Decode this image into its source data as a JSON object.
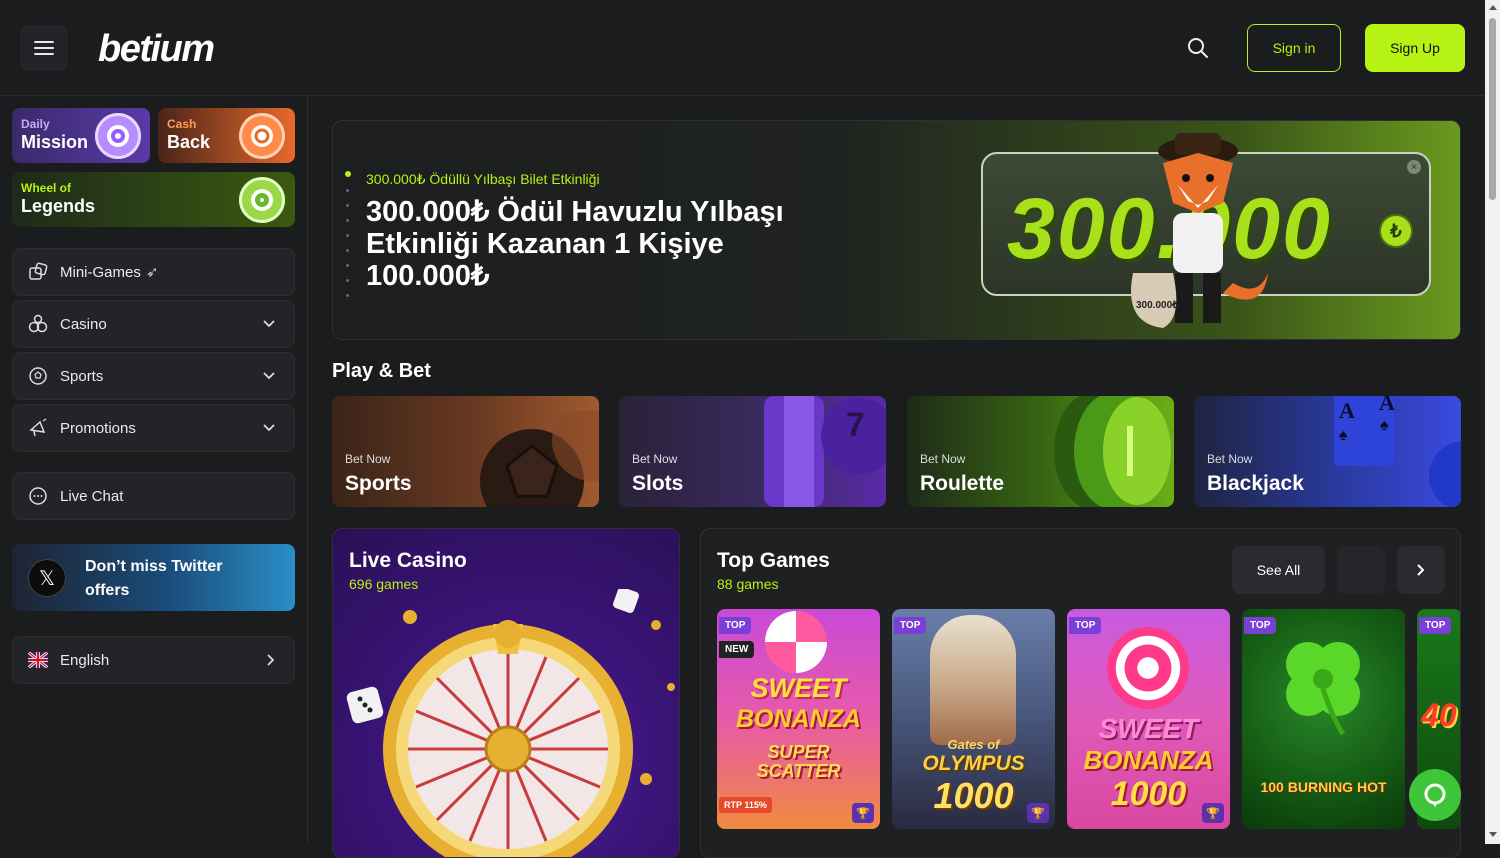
{
  "header": {
    "logo_text": "betium",
    "signin_label": "Sign in",
    "signup_label": "Sign Up"
  },
  "sidebar": {
    "promos": [
      {
        "small": "Daily",
        "big": "Mission"
      },
      {
        "small": "Cash",
        "big": "Back"
      },
      {
        "small": "Wheel of",
        "big": "Legends"
      }
    ],
    "items": [
      {
        "label": "Mini-Games"
      },
      {
        "label": "Casino"
      },
      {
        "label": "Sports"
      },
      {
        "label": "Promotions"
      },
      {
        "label": "Live Chat"
      }
    ],
    "twitter_text": "Don’t miss Twitter offers",
    "language": "English"
  },
  "hero": {
    "subtitle": "300.000₺ Ödüllü Yılbaşı Bilet Etkinliği",
    "title": "300.000₺ Ödül Havuzlu Yılbaşı Etkinliği Kazanan 1 Kişiye 100.000₺",
    "prize": "300.000",
    "bag_label": "300.000₺"
  },
  "play_bet": {
    "title": "Play & Bet",
    "cards": [
      {
        "cta": "Bet Now",
        "name": "Sports"
      },
      {
        "cta": "Bet Now",
        "name": "Slots"
      },
      {
        "cta": "Bet Now",
        "name": "Roulette"
      },
      {
        "cta": "Bet Now",
        "name": "Blackjack"
      }
    ]
  },
  "live_casino": {
    "title": "Live Casino",
    "count": "696 games"
  },
  "top_games": {
    "title": "Top Games",
    "count": "88 games",
    "see_all": "See All",
    "games": [
      {
        "tag": "TOP",
        "tag2": "NEW",
        "line1": "SWEET",
        "line2": "BONANZA",
        "line3": "SUPER SCATTER",
        "rtp": "RTP 115%"
      },
      {
        "tag": "TOP",
        "line1": "Gates of",
        "line2": "OLYMPUS",
        "line3": "1000"
      },
      {
        "tag": "TOP",
        "line1": "SWEET",
        "line2": "BONANZA",
        "line3": "1000"
      },
      {
        "tag": "TOP",
        "line1": "100 BURNING HOT"
      },
      {
        "tag": "TOP",
        "line1": "40"
      }
    ]
  },
  "colors": {
    "accent": "#b6f213",
    "bg": "#1b1c1e"
  }
}
